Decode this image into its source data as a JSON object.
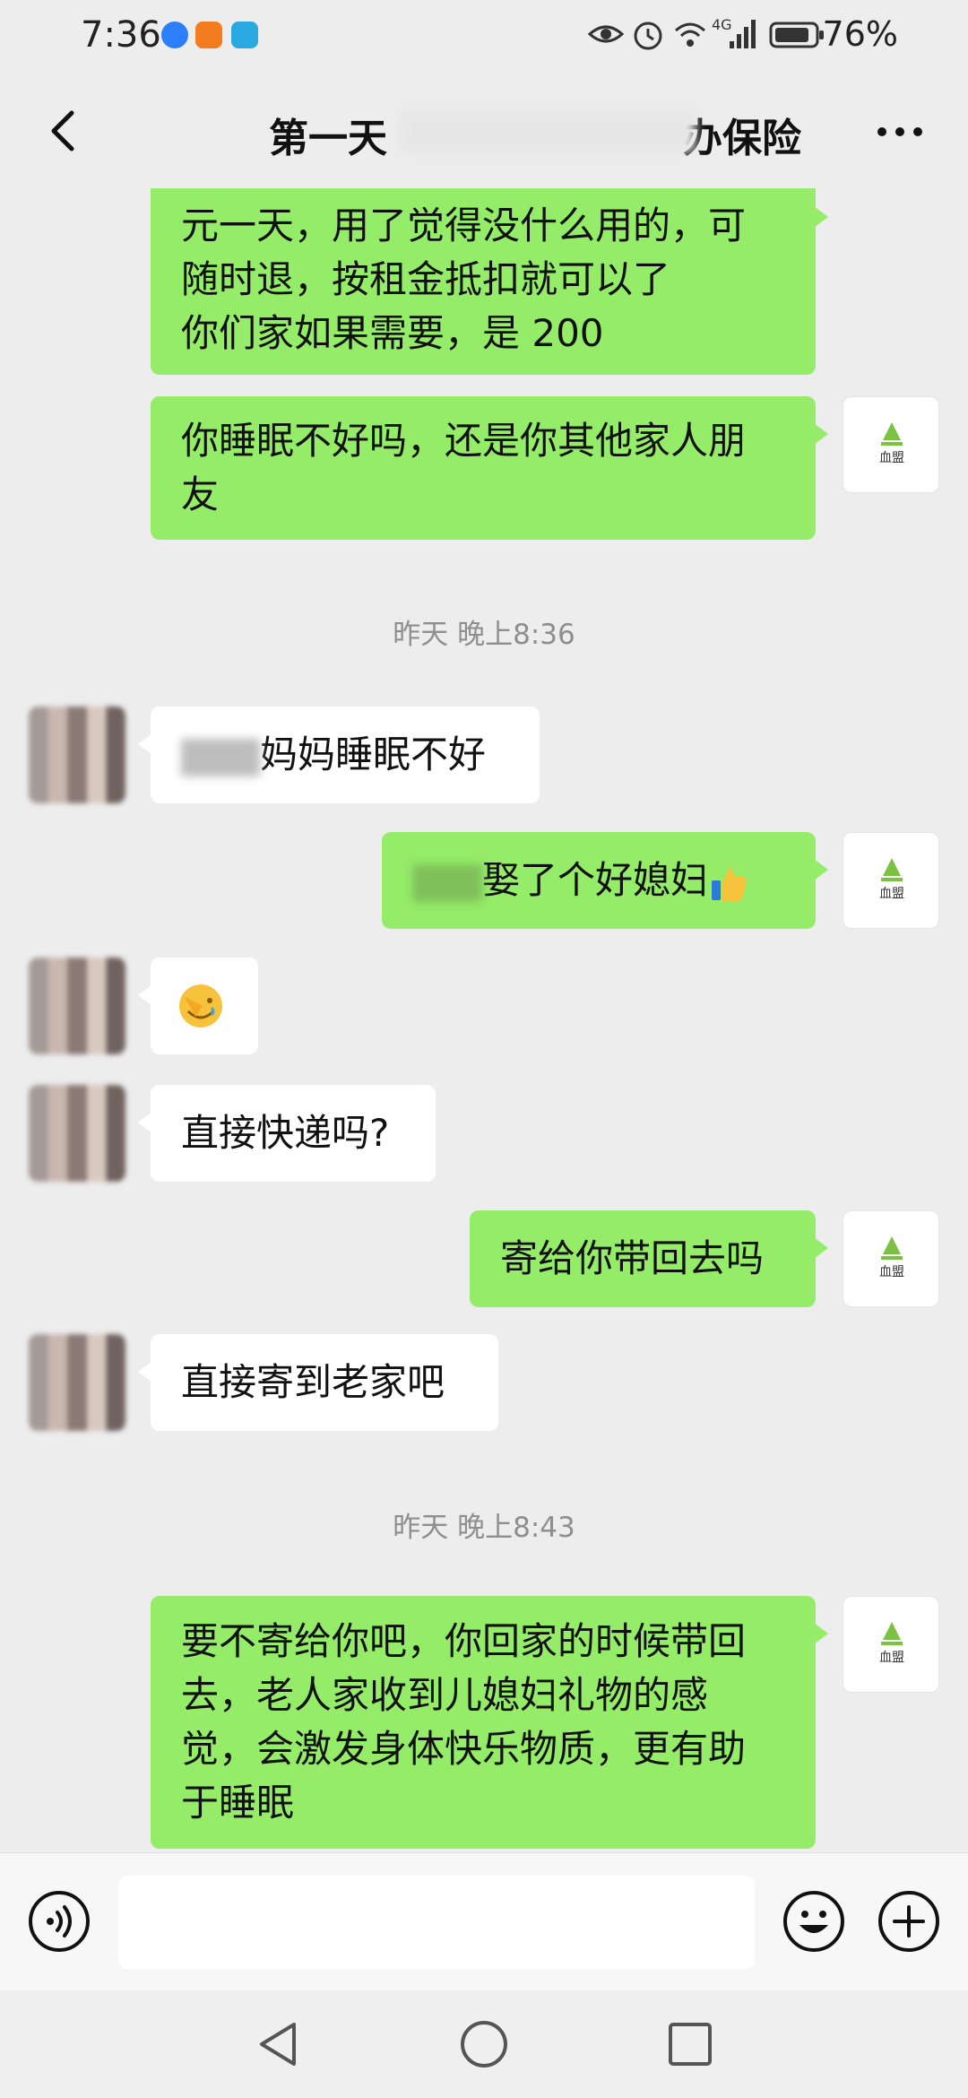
{
  "status_bar": {
    "time": "7:36",
    "battery_percent": "76%",
    "network": "4G",
    "icons": [
      "browser-app-icon",
      "video-app-icon",
      "mini-app-icon",
      "eye-icon",
      "alarm-icon",
      "wifi-icon",
      "signal-icon",
      "battery-icon"
    ]
  },
  "header": {
    "title": "第一天",
    "title_suffix_visible": "办保险",
    "back_icon": "chevron-left-icon",
    "more_icon": "more-dots-icon"
  },
  "messages": [
    {
      "type": "out",
      "lines": [
        "元一天，用了觉得没什么用的，可",
        "随时退，按租金抵扣就可以了",
        "你们家如果需要，是 200"
      ]
    },
    {
      "type": "out",
      "lines": [
        "你睡眠不好吗，还是你其他家人朋",
        "友"
      ]
    },
    {
      "type": "time",
      "text": "昨天 晚上8:36"
    },
    {
      "type": "in",
      "text": "妈妈睡眠不好"
    },
    {
      "type": "out",
      "text": "娶了个好媳妇",
      "emoji": "thumbs-up-emoji"
    },
    {
      "type": "in",
      "emoji": "facepalm-emoji"
    },
    {
      "type": "in",
      "text": "直接快递吗?"
    },
    {
      "type": "out",
      "text": "寄给你带回去吗"
    },
    {
      "type": "in",
      "text": "直接寄到老家吧"
    },
    {
      "type": "time",
      "text": "昨天 晚上8:43"
    },
    {
      "type": "out",
      "lines": [
        "要不寄给你吧，你回家的时候带回",
        "去，老人家收到儿媳妇礼物的感",
        "觉，会激发身体快乐物质，更有助",
        "于睡眠"
      ]
    }
  ],
  "my_avatar_text": "血盟",
  "input_bar": {
    "placeholder": "",
    "voice_icon": "voice-icon",
    "emoji_icon": "emoji-icon",
    "plus_icon": "plus-icon"
  },
  "nav_bar": {
    "icons": [
      "nav-back-icon",
      "nav-home-icon",
      "nav-recents-icon"
    ]
  },
  "colors": {
    "outgoing_bubble": "#95ec69",
    "incoming_bubble": "#ffffff",
    "chat_background": "#ededed"
  }
}
